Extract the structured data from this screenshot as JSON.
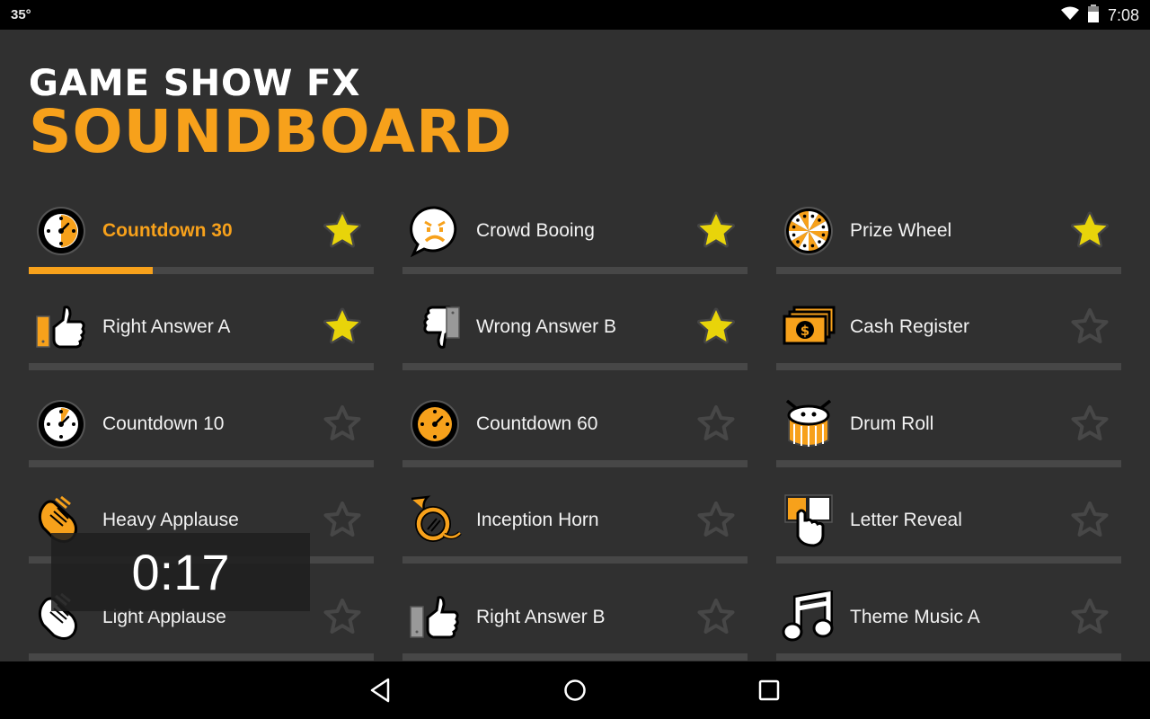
{
  "status_bar": {
    "temperature": "35°",
    "time": "7:08",
    "icons": [
      "wifi-icon",
      "battery-icon"
    ]
  },
  "header": {
    "title_line1": "GAME SHOW FX",
    "title_line2": "SOUNDBOARD"
  },
  "colors": {
    "accent": "#f7a11b",
    "star_filled": "#e8d40a",
    "background": "#303030",
    "track": "#474747"
  },
  "sounds": [
    {
      "label": "Countdown 30",
      "icon": "countdown-30-clock-icon",
      "favorite": true,
      "playing": true,
      "progress": 0.36
    },
    {
      "label": "Crowd Booing",
      "icon": "angry-speech-bubble-icon",
      "favorite": true,
      "playing": false,
      "progress": 0
    },
    {
      "label": "Prize Wheel",
      "icon": "prize-wheel-icon",
      "favorite": true,
      "playing": false,
      "progress": 0
    },
    {
      "label": "Right Answer A",
      "icon": "thumbs-up-buzzer-icon",
      "favorite": true,
      "playing": false,
      "progress": 0
    },
    {
      "label": "Wrong Answer B",
      "icon": "thumbs-down-buzzer-icon",
      "favorite": true,
      "playing": false,
      "progress": 0
    },
    {
      "label": "Cash Register",
      "icon": "cash-stack-icon",
      "favorite": false,
      "playing": false,
      "progress": 0
    },
    {
      "label": "Countdown 10",
      "icon": "countdown-10-clock-icon",
      "favorite": false,
      "playing": false,
      "progress": 0
    },
    {
      "label": "Countdown 60",
      "icon": "countdown-60-clock-icon",
      "favorite": false,
      "playing": false,
      "progress": 0
    },
    {
      "label": "Drum Roll",
      "icon": "drum-icon",
      "favorite": false,
      "playing": false,
      "progress": 0
    },
    {
      "label": "Heavy Applause",
      "icon": "clapping-hands-orange-icon",
      "favorite": false,
      "playing": false,
      "progress": 0
    },
    {
      "label": "Inception Horn",
      "icon": "french-horn-icon",
      "favorite": false,
      "playing": false,
      "progress": 0
    },
    {
      "label": "Letter Reveal",
      "icon": "letter-reveal-hand-icon",
      "favorite": false,
      "playing": false,
      "progress": 0
    },
    {
      "label": "Light Applause",
      "icon": "clapping-hands-white-icon",
      "favorite": false,
      "playing": false,
      "progress": 0
    },
    {
      "label": "Right Answer B",
      "icon": "thumbs-up-gray-buzzer-icon",
      "favorite": false,
      "playing": false,
      "progress": 0
    },
    {
      "label": "Theme Music A",
      "icon": "music-note-icon",
      "favorite": false,
      "playing": false,
      "progress": 0
    }
  ],
  "timer_overlay": {
    "time": "0:17"
  },
  "nav_bar": {
    "buttons": [
      "back",
      "home",
      "recents"
    ]
  }
}
